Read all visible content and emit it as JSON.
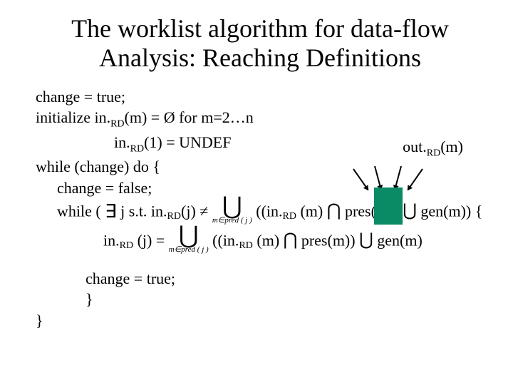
{
  "title": "The worklist algorithm for data-flow Analysis: Reaching Definitions",
  "lines": {
    "l1": "change = true;",
    "l2a": "initialize in.",
    "l2b": "RD",
    "l2c": "(m) = Ø for m=2…n",
    "l3a": "in.",
    "l3b": "RD",
    "l3c": "(1) = UNDEF",
    "out_a": "out.",
    "out_b": "RD",
    "out_c": "(m)",
    "l4": "while (change) do {",
    "l5": "change = false;",
    "l6a": "while (",
    "l6_exists": "∃",
    "l6b": " j s.t. in.",
    "l6c": "RD",
    "l6d": "(j) ≠",
    "l6_op": "⋃",
    "l6_under": "m∈pred ( j )",
    "l6e": "((in.",
    "l6f": "RD",
    "l6g": " (m)",
    "l6_cap1": "⋂",
    "l6h": "pres(m))",
    "l6_cup1": "⋃",
    "l6i": "gen(m)) {",
    "l7a": "in.",
    "l7b": "RD",
    "l7c": " (j) = ",
    "l7_op": "⋃",
    "l7_under": "m∈pred ( j )",
    "l7d": "((in.",
    "l7e": "RD",
    "l7f": " (m)",
    "l7_cap": "⋂",
    "l7g": "pres(m))",
    "l7_cup": "⋃",
    "l7h": "gen(m)",
    "l8": "change = true;",
    "l9": "}",
    "l10": "}"
  }
}
